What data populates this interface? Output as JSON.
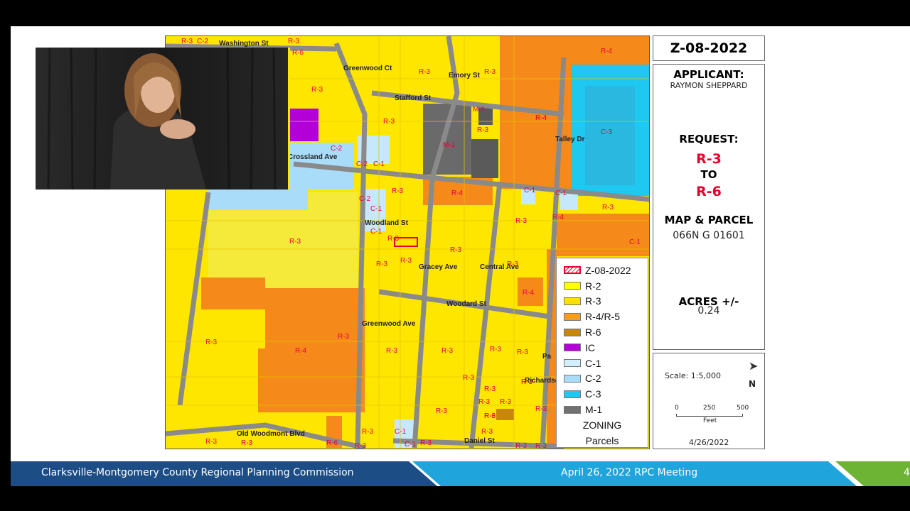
{
  "footer": {
    "left_text": "Clarksville-Montgomery County Regional Planning Commission",
    "center_text": "April 26, 2022 RPC Meeting",
    "page_number": "4"
  },
  "case": {
    "number": "Z-08-2022",
    "applicant_label": "APPLICANT:",
    "applicant_name": "RAYMON SHEPPARD",
    "request_label": "REQUEST:",
    "from_zone": "R-3",
    "to_label": "TO",
    "to_zone": "R-6",
    "map_parcel_label": "MAP & PARCEL",
    "map_parcel_value": "066N G 01601",
    "acres_label": "ACRES +/-",
    "acres_value": "0.24"
  },
  "scale": {
    "scale_text": "Scale: 1:5,000",
    "ticks": [
      "0",
      "250",
      "500"
    ],
    "unit": "Feet",
    "north_label": "N",
    "date": "4/26/2022"
  },
  "legend": {
    "items": [
      {
        "label": "Z-08-2022",
        "color": "#ffffff"
      },
      {
        "label": "R-2",
        "color": "#ffff00"
      },
      {
        "label": "R-3",
        "color": "#ffe000"
      },
      {
        "label": "R-4/R-5",
        "color": "#ff9a1e"
      },
      {
        "label": "R-6",
        "color": "#c8860a"
      },
      {
        "label": "IC",
        "color": "#b400d8"
      },
      {
        "label": "C-1",
        "color": "#d2eeff"
      },
      {
        "label": "C-2",
        "color": "#a8dcf8"
      },
      {
        "label": "C-3",
        "color": "#1ec8f0"
      },
      {
        "label": "M-1",
        "color": "#707070"
      }
    ],
    "footer_line1": "ZONING",
    "footer_line2": "Parcels"
  },
  "map": {
    "streets": [
      "Washington St",
      "Greenwood Ct",
      "Stafford St",
      "Emory St",
      "Talley Dr",
      "Crossland Ave",
      "Woodland St",
      "Gracey Ave",
      "Central Ave",
      "Woodard St",
      "Greenwood Ave",
      "Richardson St",
      "Old Woodmont Blvd",
      "Daniel St",
      "Pa"
    ],
    "zone_labels": [
      "R-3",
      "C-2",
      "R-6",
      "R-3",
      "R-3",
      "R-3",
      "R-3",
      "R-4",
      "R-3",
      "M-1",
      "R-3",
      "R-4",
      "C-3",
      "M-1",
      "C-2",
      "C-2",
      "C-1",
      "R-3",
      "R-4",
      "C-1",
      "C-1",
      "C-2",
      "R-3",
      "C-1",
      "R-3",
      "R-3",
      "C-1",
      "R-3",
      "R-4",
      "C-1",
      "R-3",
      "R-3",
      "R-3",
      "R-3",
      "R-3",
      "R-4",
      "R-3",
      "R-3",
      "R-4",
      "R-3",
      "R-3",
      "R-3",
      "R-3",
      "R-3",
      "R-3",
      "R-3",
      "R-6",
      "R-3",
      "R-3",
      "R-3",
      "R-3",
      "R-6",
      "C-1",
      "C-1",
      "R-3",
      "R-3",
      "R-3",
      "R-3",
      "R-3",
      "R-3",
      "R-3",
      "R-3"
    ]
  }
}
